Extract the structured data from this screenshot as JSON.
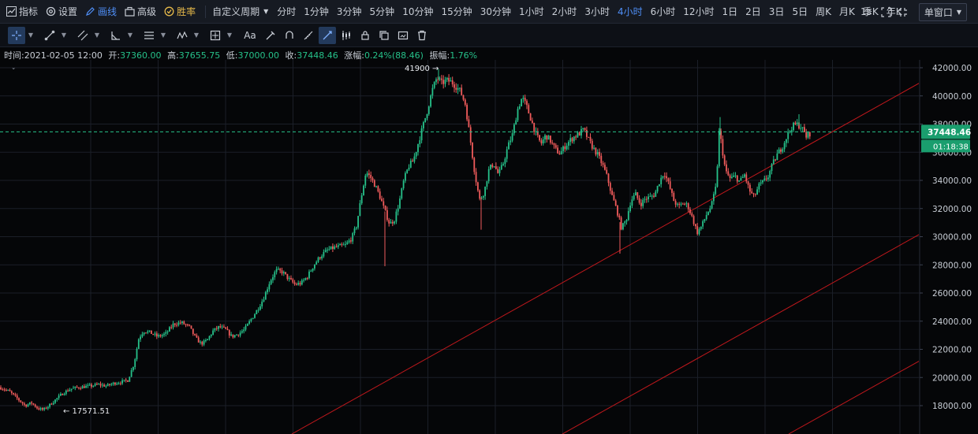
{
  "toolbar": {
    "indicators_label": "指标",
    "settings_label": "设置",
    "draw_label": "画线",
    "advanced_label": "高级",
    "winrate_label": "胜率",
    "custom_period_label": "自定义周期",
    "periods": [
      "分时",
      "1分钟",
      "3分钟",
      "5分钟",
      "10分钟",
      "15分钟",
      "30分钟",
      "1小时",
      "2小时",
      "3小时",
      "4小时",
      "6小时",
      "12小时",
      "1日",
      "2日",
      "3日",
      "5日",
      "周K",
      "月K",
      "季K",
      "年K"
    ],
    "active_period": "4小时",
    "speed_label": "1s",
    "window_mode_label": "单窗口"
  },
  "drawing_tools": {
    "text_tool_label": "Aa"
  },
  "info": {
    "time_label": "时间:",
    "time_value": "2021-02-05 12:00",
    "open_label": "开:",
    "open_value": "37360.00",
    "high_label": "高:",
    "high_value": "37655.75",
    "low_label": "低:",
    "low_value": "37000.00",
    "close_label": "收:",
    "close_value": "37448.46",
    "change_label": "涨幅:",
    "change_value": "0.24%(88.46)",
    "amplitude_label": "振幅:",
    "amplitude_value": "1.76%"
  },
  "price_axis": {
    "ticks": [
      "42000.00",
      "40000.00",
      "38000.00",
      "36000.00",
      "34000.00",
      "32000.00",
      "30000.00",
      "28000.00",
      "26000.00",
      "24000.00",
      "22000.00",
      "20000.00",
      "18000.00"
    ],
    "current_price": "37448.46",
    "countdown": "01:18:38"
  },
  "annotations": {
    "high_marker": "41900 →",
    "low_marker": "← 17571.51"
  },
  "colors": {
    "up": "#26c18a",
    "down": "#f05b5b",
    "channel": "#c0181c",
    "accent": "#4f8ff7",
    "price_tag": "#1a9e6e"
  },
  "chart_data": {
    "type": "candlestick",
    "interval": "4小时",
    "ylim": [
      17000,
      43000
    ],
    "yticks": [
      18000,
      20000,
      22000,
      24000,
      26000,
      28000,
      30000,
      32000,
      34000,
      36000,
      38000,
      40000,
      42000
    ],
    "last_candle": {
      "time": "2021-02-05 12:00",
      "open": 37360.0,
      "high": 37655.75,
      "low": 37000.0,
      "close": 37448.46
    },
    "marked_high": 41900,
    "marked_low": 17571.51,
    "path_anchors": [
      [
        0,
        19300
      ],
      [
        12,
        19000
      ],
      [
        24,
        18400
      ],
      [
        32,
        18000
      ],
      [
        40,
        18200
      ],
      [
        48,
        17800
      ],
      [
        55,
        17700
      ],
      [
        62,
        18000
      ],
      [
        70,
        18400
      ],
      [
        80,
        18900
      ],
      [
        90,
        19200
      ],
      [
        100,
        19300
      ],
      [
        115,
        19400
      ],
      [
        125,
        19500
      ],
      [
        135,
        19400
      ],
      [
        145,
        19600
      ],
      [
        155,
        19700
      ],
      [
        162,
        19800
      ],
      [
        170,
        21000
      ],
      [
        176,
        22800
      ],
      [
        182,
        23300
      ],
      [
        190,
        23200
      ],
      [
        200,
        22900
      ],
      [
        210,
        23100
      ],
      [
        220,
        23800
      ],
      [
        230,
        23900
      ],
      [
        240,
        23600
      ],
      [
        248,
        22800
      ],
      [
        255,
        22400
      ],
      [
        262,
        22600
      ],
      [
        270,
        23300
      ],
      [
        278,
        23600
      ],
      [
        286,
        23400
      ],
      [
        294,
        22900
      ],
      [
        302,
        23100
      ],
      [
        310,
        23400
      ],
      [
        318,
        24100
      ],
      [
        326,
        24800
      ],
      [
        334,
        25600
      ],
      [
        342,
        26800
      ],
      [
        350,
        27600
      ],
      [
        358,
        27500
      ],
      [
        366,
        27000
      ],
      [
        374,
        26600
      ],
      [
        382,
        26700
      ],
      [
        390,
        27200
      ],
      [
        398,
        28000
      ],
      [
        406,
        28600
      ],
      [
        414,
        29000
      ],
      [
        422,
        29200
      ],
      [
        430,
        29300
      ],
      [
        438,
        29400
      ],
      [
        446,
        29900
      ],
      [
        452,
        30800
      ],
      [
        458,
        32800
      ],
      [
        464,
        34600
      ],
      [
        470,
        34200
      ],
      [
        476,
        33600
      ],
      [
        482,
        32800
      ],
      [
        488,
        31800
      ],
      [
        494,
        30900
      ],
      [
        500,
        31200
      ],
      [
        506,
        32400
      ],
      [
        512,
        34000
      ],
      [
        518,
        35000
      ],
      [
        524,
        35400
      ],
      [
        530,
        36600
      ],
      [
        536,
        37800
      ],
      [
        542,
        39000
      ],
      [
        548,
        40400
      ],
      [
        554,
        41300
      ],
      [
        560,
        40900
      ],
      [
        566,
        41100
      ],
      [
        572,
        41000
      ],
      [
        578,
        40700
      ],
      [
        584,
        40300
      ],
      [
        590,
        39400
      ],
      [
        596,
        37000
      ],
      [
        602,
        34500
      ],
      [
        608,
        32600
      ],
      [
        614,
        33200
      ],
      [
        620,
        34800
      ],
      [
        626,
        35200
      ],
      [
        632,
        34400
      ],
      [
        638,
        35200
      ],
      [
        644,
        36400
      ],
      [
        650,
        37300
      ],
      [
        656,
        39000
      ],
      [
        662,
        39900
      ],
      [
        668,
        39200
      ],
      [
        674,
        38200
      ],
      [
        680,
        37200
      ],
      [
        686,
        36600
      ],
      [
        692,
        37200
      ],
      [
        698,
        36800
      ],
      [
        704,
        36200
      ],
      [
        710,
        35900
      ],
      [
        716,
        36400
      ],
      [
        722,
        36800
      ],
      [
        728,
        37100
      ],
      [
        734,
        37300
      ],
      [
        740,
        37600
      ],
      [
        746,
        36900
      ],
      [
        752,
        36300
      ],
      [
        758,
        35800
      ],
      [
        764,
        35100
      ],
      [
        770,
        34200
      ],
      [
        776,
        32900
      ],
      [
        782,
        31900
      ],
      [
        788,
        30600
      ],
      [
        794,
        31200
      ],
      [
        800,
        32600
      ],
      [
        806,
        33000
      ],
      [
        812,
        32300
      ],
      [
        818,
        32700
      ],
      [
        824,
        32800
      ],
      [
        830,
        33000
      ],
      [
        836,
        33900
      ],
      [
        842,
        34600
      ],
      [
        848,
        33700
      ],
      [
        854,
        32600
      ],
      [
        860,
        32100
      ],
      [
        866,
        32400
      ],
      [
        872,
        32200
      ],
      [
        878,
        31300
      ],
      [
        884,
        30300
      ],
      [
        890,
        30800
      ],
      [
        896,
        31600
      ],
      [
        902,
        32200
      ],
      [
        908,
        33600
      ],
      [
        912,
        37600
      ],
      [
        916,
        36100
      ],
      [
        920,
        34600
      ],
      [
        926,
        34100
      ],
      [
        932,
        34300
      ],
      [
        938,
        33900
      ],
      [
        944,
        34400
      ],
      [
        950,
        33300
      ],
      [
        956,
        32800
      ],
      [
        962,
        33600
      ],
      [
        968,
        33900
      ],
      [
        974,
        34300
      ],
      [
        980,
        35200
      ],
      [
        986,
        35900
      ],
      [
        992,
        36400
      ],
      [
        998,
        37200
      ],
      [
        1004,
        37800
      ],
      [
        1010,
        38000
      ],
      [
        1016,
        37800
      ],
      [
        1022,
        37100
      ],
      [
        1028,
        37400
      ]
    ]
  }
}
